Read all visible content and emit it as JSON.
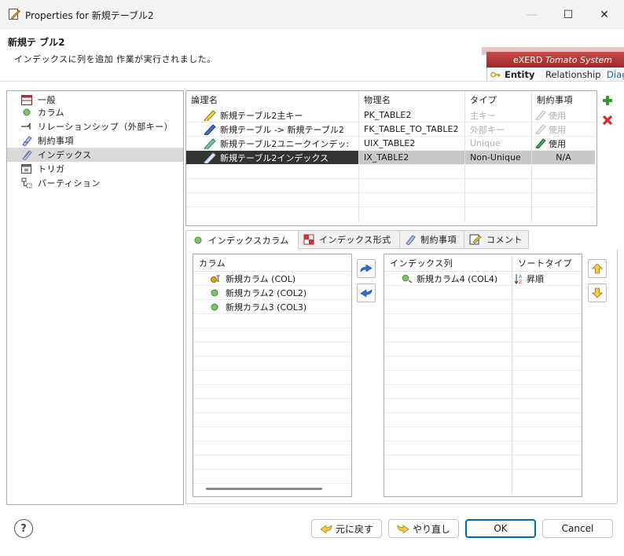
{
  "window": {
    "title": "Properties for 新規テーブル2",
    "minimize": "—",
    "maximize": "☐",
    "close": "✕"
  },
  "header": {
    "title": "新規テ ブル2",
    "message": "インデックスに列を追加 作業が実行されました。"
  },
  "banner": {
    "brand": "eXERD",
    "product": "Tomato System",
    "tabs": [
      "Entity",
      "Relationship",
      "Diag"
    ]
  },
  "tree": {
    "items": [
      {
        "label": "一般",
        "icon": "table-icon"
      },
      {
        "label": "カラム",
        "icon": "column-dot-icon"
      },
      {
        "label": "リレーションシップ（外部キー）",
        "icon": "relationship-icon"
      },
      {
        "label": "制約事項",
        "icon": "constraint-icon"
      },
      {
        "label": "インデックス",
        "icon": "index-icon",
        "selected": true
      },
      {
        "label": "トリガ",
        "icon": "trigger-icon"
      },
      {
        "label": "パーティション",
        "icon": "partition-icon"
      }
    ]
  },
  "index_table": {
    "headers": [
      "論理名",
      "物理名",
      "タイプ",
      "制約事項"
    ],
    "rows": [
      {
        "logical": "新規テーブル2主キー",
        "physical": "PK_TABLE2",
        "type": "主キー",
        "constraint": "使用",
        "type_disabled": true,
        "constraint_disabled": true,
        "icon_color": "#d9b400"
      },
      {
        "logical": "新規テーブル -> 新規テーブル2",
        "physical": "FK_TABLE_TO_TABLE2",
        "type": "外部キー",
        "constraint": "使用",
        "type_disabled": true,
        "constraint_disabled": true,
        "icon_color": "#2d5fc4"
      },
      {
        "logical": "新規テーブル2ユニークインデッ:",
        "physical": "UIX_TABLE2",
        "type": "Unique",
        "constraint": "使用",
        "type_disabled": true,
        "constraint_disabled": false,
        "icon_color": "#4aa88a"
      },
      {
        "logical": "新規テーブル2インデックス",
        "physical": "IX_TABLE2",
        "type": "Non-Unique",
        "constraint": "N/A",
        "type_disabled": false,
        "constraint_disabled": false,
        "selected": true,
        "icon_color": "#4466aa"
      }
    ]
  },
  "tabs": [
    {
      "label": "インデックスカラム",
      "icon": "column-dot-icon",
      "active": true
    },
    {
      "label": "インデックス形式",
      "icon": "index-format-icon"
    },
    {
      "label": "制約事項",
      "icon": "constraint-icon"
    },
    {
      "label": "コメント",
      "icon": "comment-icon"
    }
  ],
  "columns_list": {
    "header": "カラム",
    "items": [
      {
        "label": "新規カラム (COL)",
        "icon": "pk-column-icon"
      },
      {
        "label": "新規カラム2 (COL2)",
        "icon": "column-dot-icon"
      },
      {
        "label": "新規カラム3 (COL3)",
        "icon": "column-dot-icon"
      }
    ]
  },
  "index_columns": {
    "headers": [
      "インデックス列",
      "ソートタイプ"
    ],
    "rows": [
      {
        "column": "新規カラム4 (COL4)",
        "sort": "昇順"
      }
    ]
  },
  "footer": {
    "help": "?",
    "revert": "元に戻す",
    "redo": "やり直し",
    "ok": "OK",
    "cancel": "Cancel"
  },
  "colors": {
    "accent": "#0067c0",
    "banner_red": "#b23434",
    "selected_row_dark": "#333333",
    "add_green": "#3b9a2e",
    "delete_red": "#d12c2c",
    "arrow_blue": "#2a6fd0",
    "updown_yellow": "#e8b820"
  }
}
